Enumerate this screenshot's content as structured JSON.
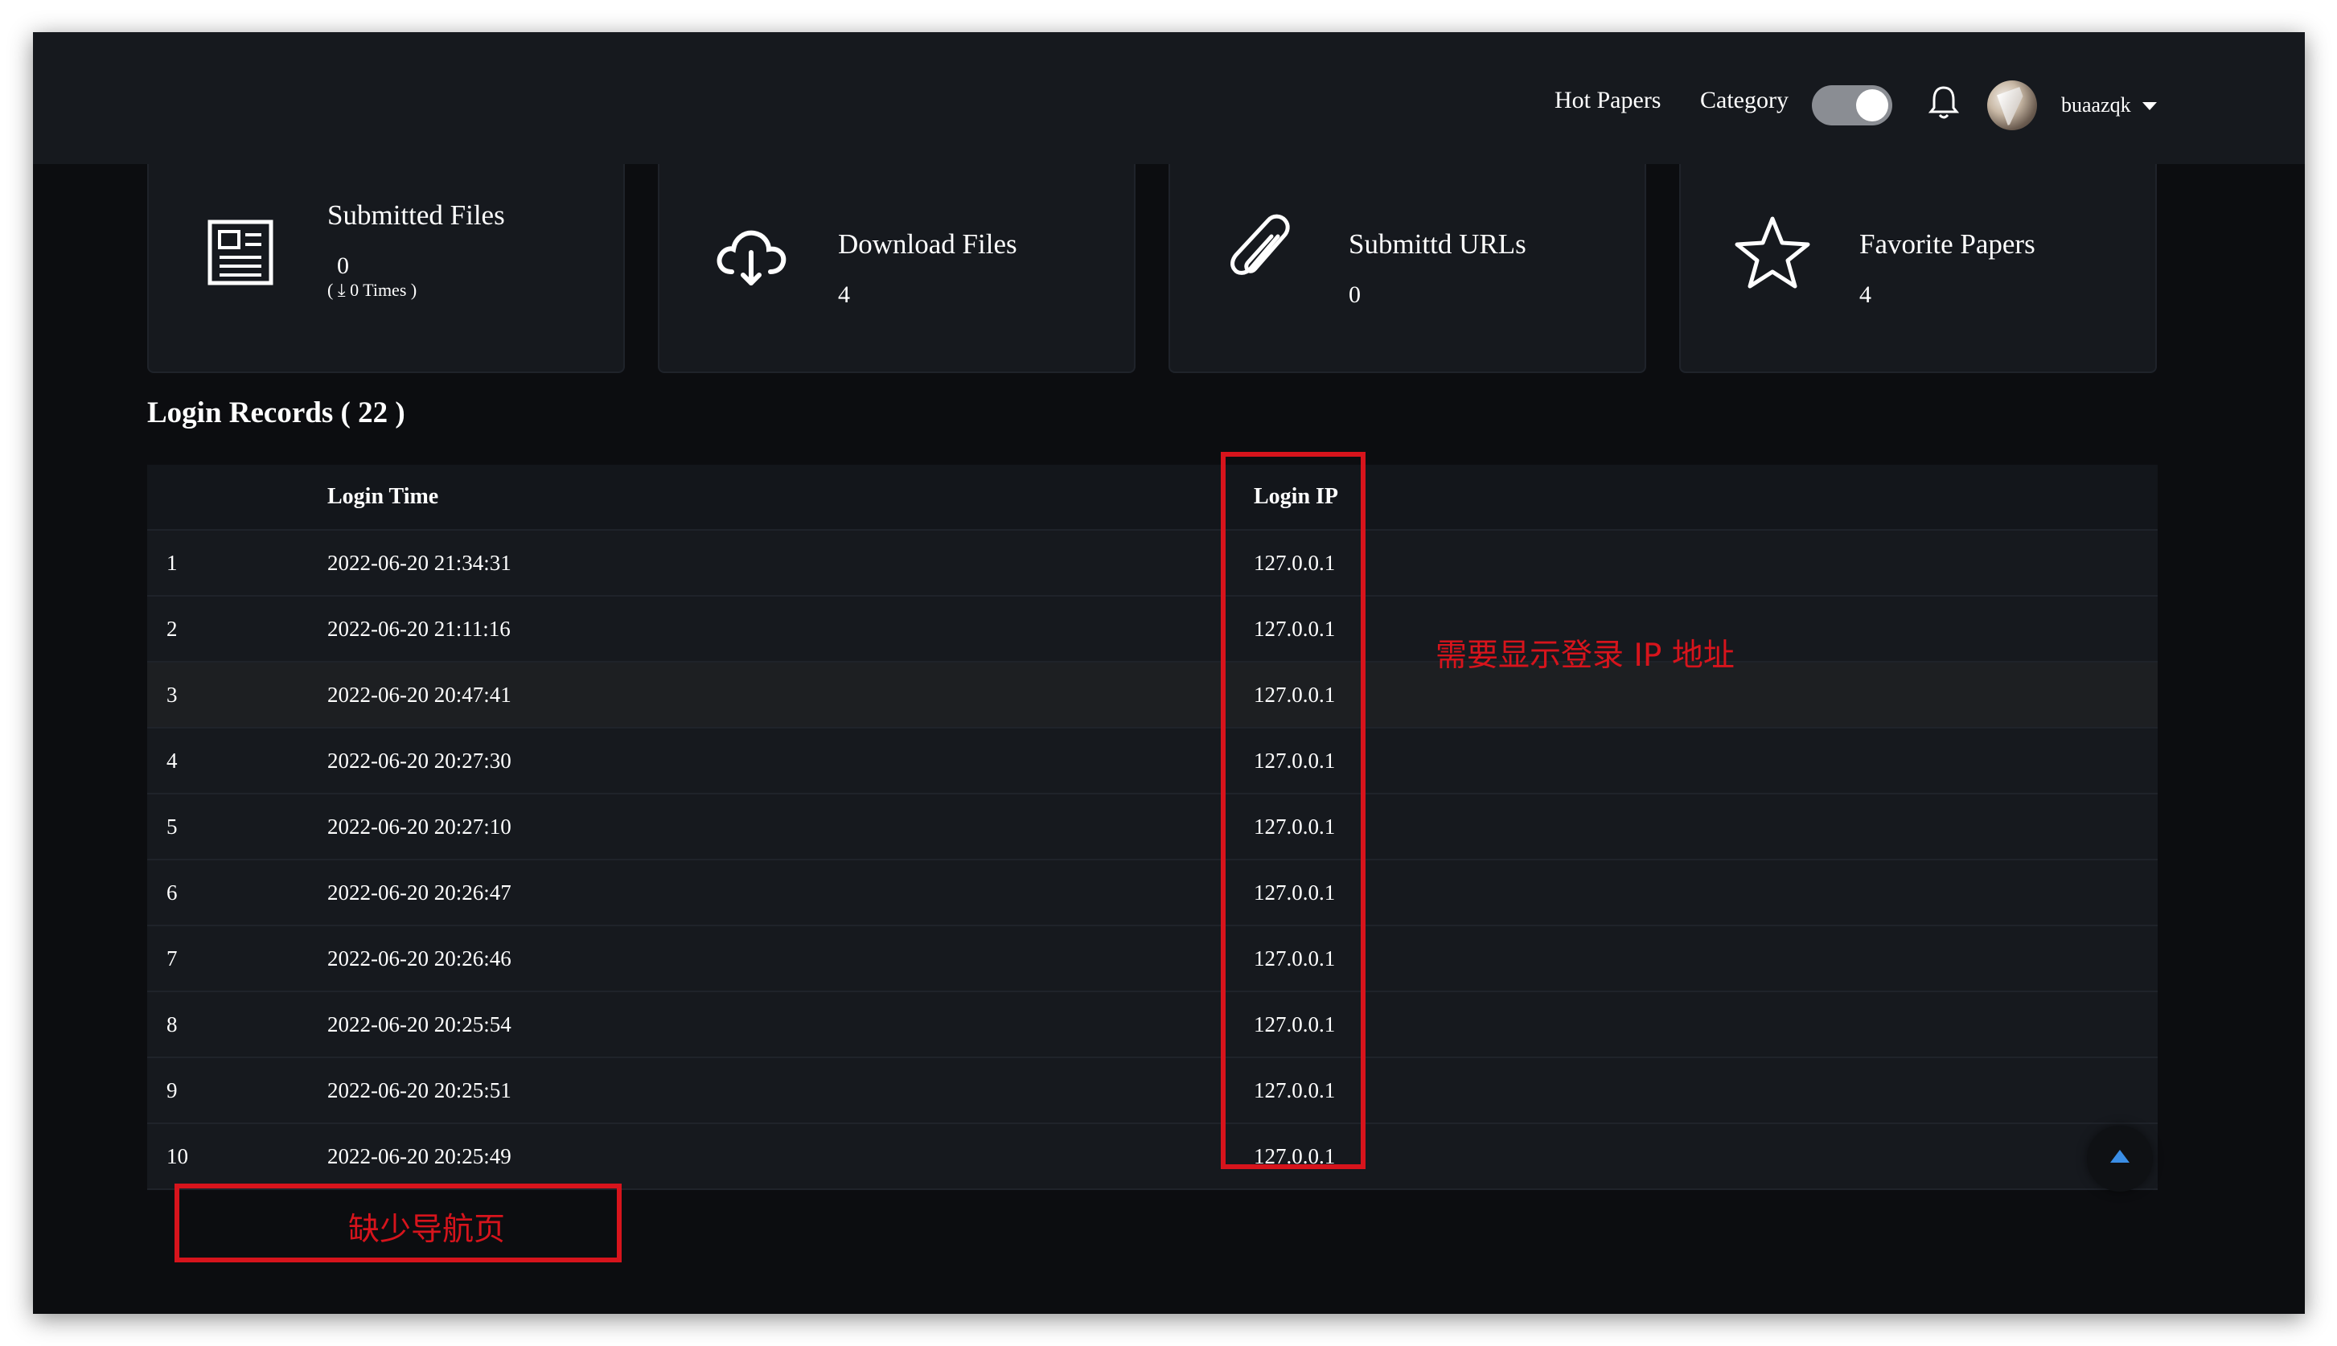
{
  "header": {
    "nav": [
      "Hot Papers",
      "Category"
    ],
    "username": "buaazqk"
  },
  "cards": [
    {
      "title": "Submitted Files",
      "value": "0",
      "sub_count": "0 Times",
      "icon": "newspaper-icon"
    },
    {
      "title": "Download Files",
      "value": "4",
      "icon": "cloud-download-icon"
    },
    {
      "title": "Submittd URLs",
      "value": "0",
      "icon": "paperclip-icon"
    },
    {
      "title": "Favorite Papers",
      "value": "4",
      "icon": "star-icon"
    }
  ],
  "login_records": {
    "title": "Login Records ( 22 )",
    "headers": {
      "index": "",
      "time": "Login Time",
      "ip": "Login IP"
    },
    "rows": [
      {
        "idx": "1",
        "time": "2022-06-20 21:34:31",
        "ip": "127.0.0.1"
      },
      {
        "idx": "2",
        "time": "2022-06-20 21:11:16",
        "ip": "127.0.0.1"
      },
      {
        "idx": "3",
        "time": "2022-06-20 20:47:41",
        "ip": "127.0.0.1"
      },
      {
        "idx": "4",
        "time": "2022-06-20 20:27:30",
        "ip": "127.0.0.1"
      },
      {
        "idx": "5",
        "time": "2022-06-20 20:27:10",
        "ip": "127.0.0.1"
      },
      {
        "idx": "6",
        "time": "2022-06-20 20:26:47",
        "ip": "127.0.0.1"
      },
      {
        "idx": "7",
        "time": "2022-06-20 20:26:46",
        "ip": "127.0.0.1"
      },
      {
        "idx": "8",
        "time": "2022-06-20 20:25:54",
        "ip": "127.0.0.1"
      },
      {
        "idx": "9",
        "time": "2022-06-20 20:25:51",
        "ip": "127.0.0.1"
      },
      {
        "idx": "10",
        "time": "2022-06-20 20:25:49",
        "ip": "127.0.0.1"
      }
    ]
  },
  "annotations": {
    "ip_note": "需要显示登录 IP 地址",
    "pager_note": "缺少导航页",
    "color": "#d7141c"
  },
  "colors": {
    "background": "#0c0d10",
    "panel": "#16191e",
    "accent_blue": "#3a8ee6"
  }
}
